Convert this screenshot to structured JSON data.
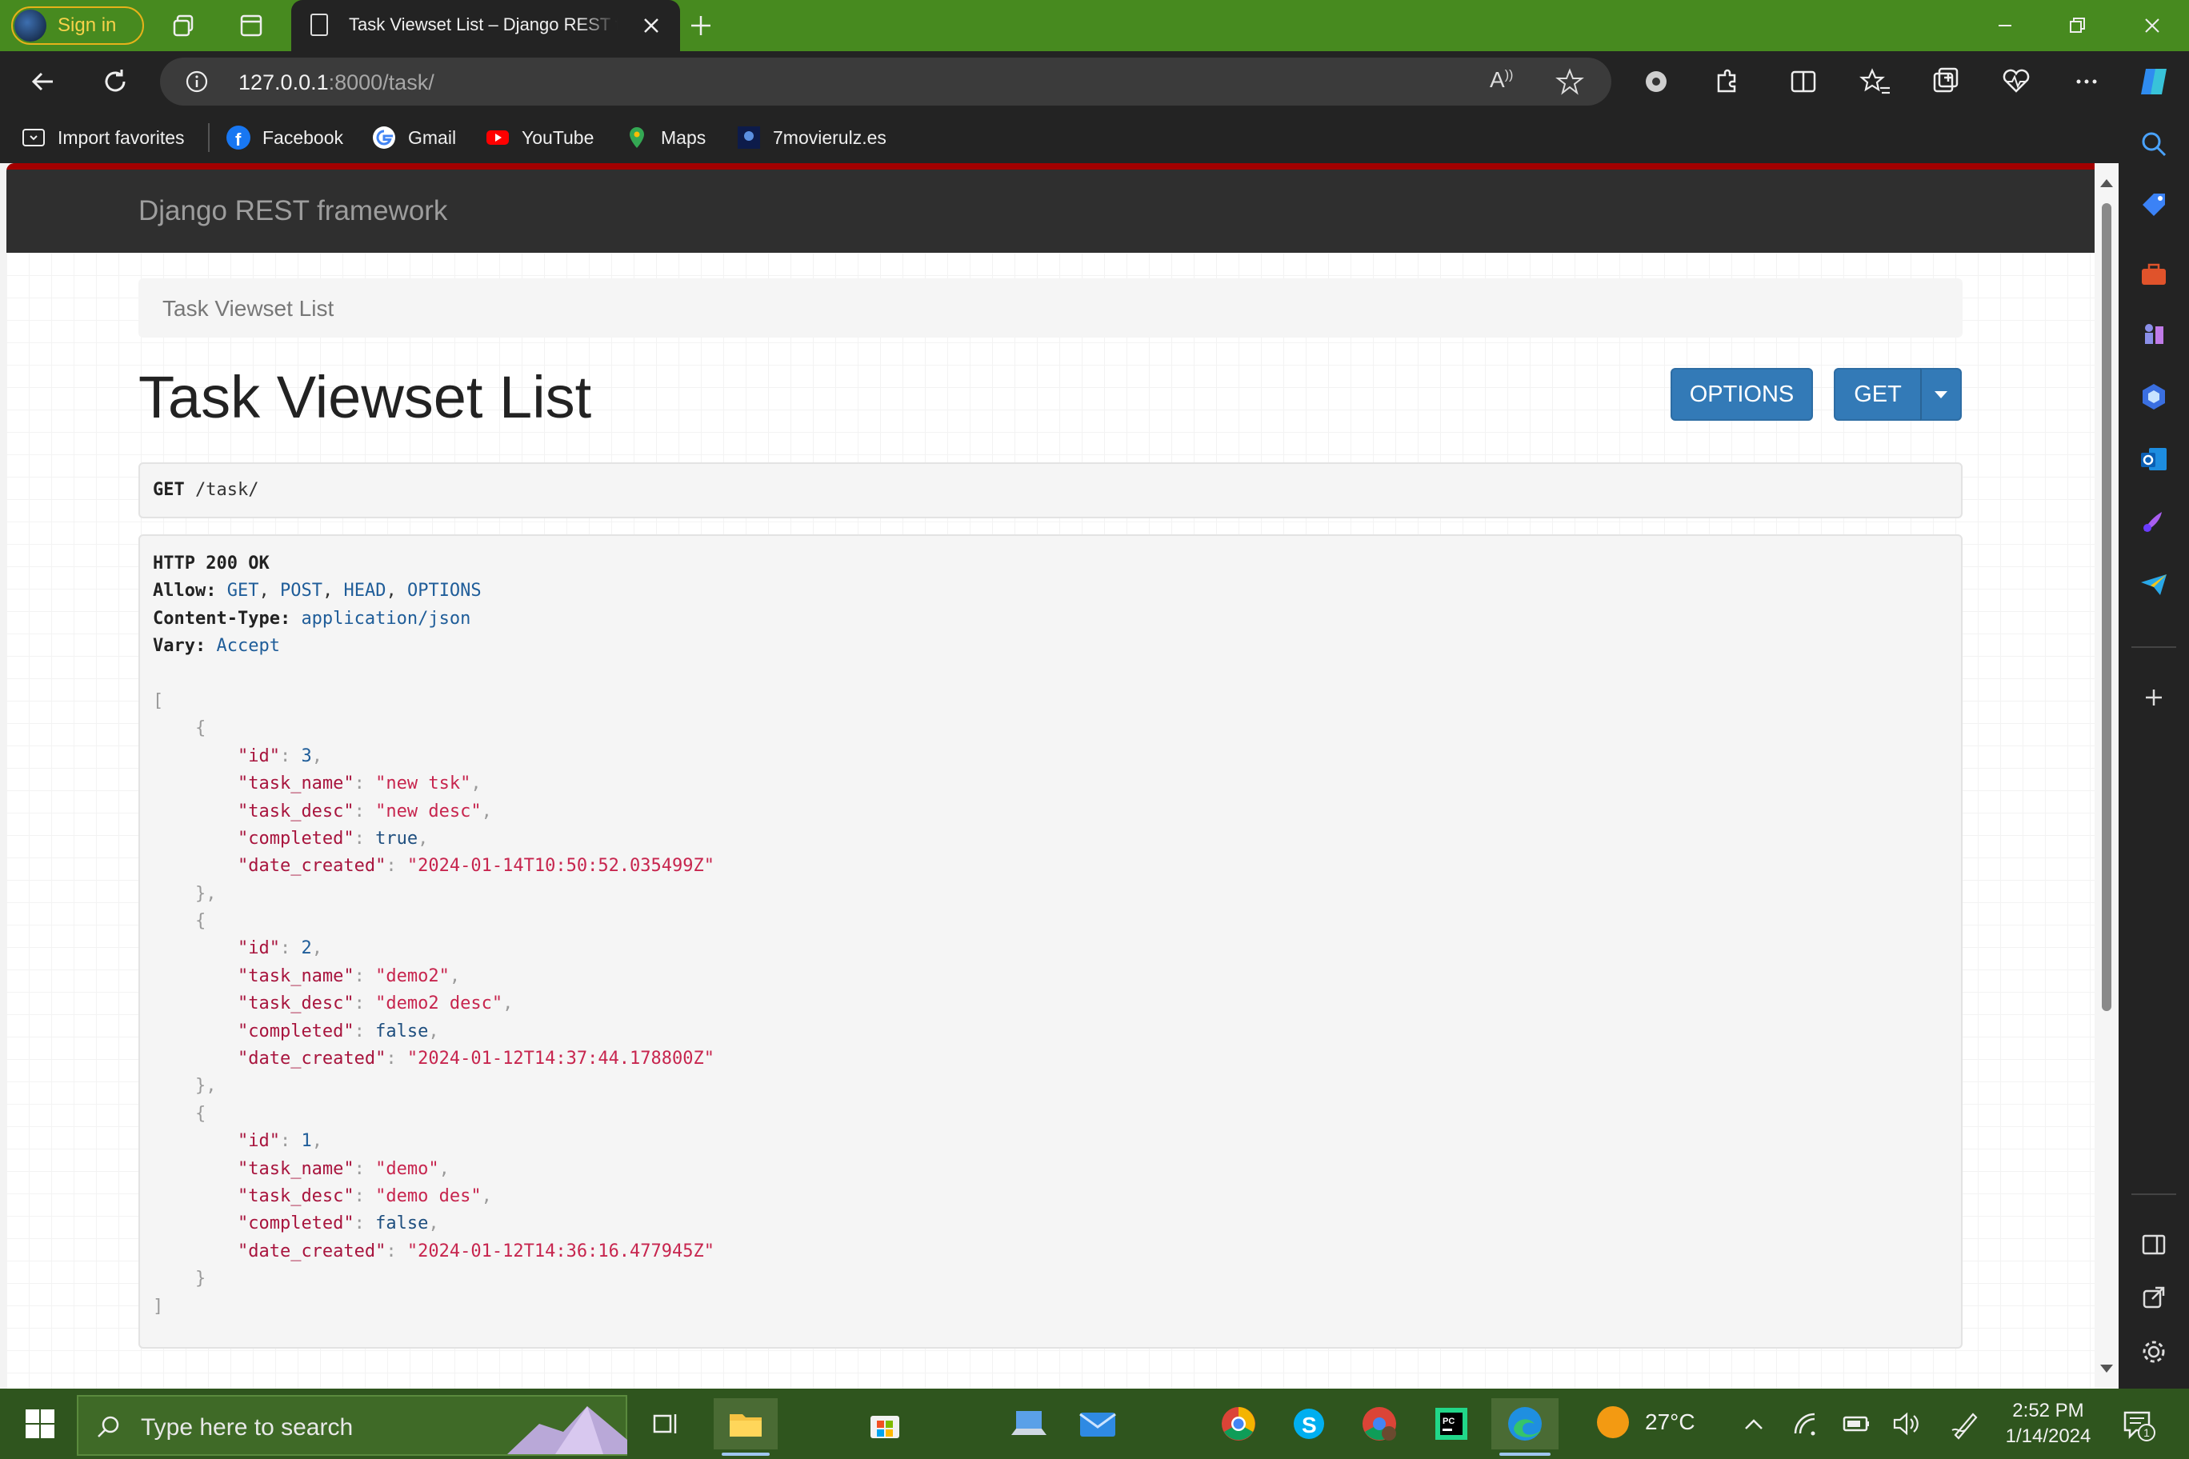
{
  "browser": {
    "signin_label": "Sign in",
    "tab_title": "Task Viewset List – Django REST framework",
    "url_host": "127.0.0.1",
    "url_rest": ":8000/task/"
  },
  "favorites": [
    {
      "label": "Import favorites",
      "icon": "import-favorites-icon"
    },
    {
      "label": "Facebook",
      "icon": "facebook-icon"
    },
    {
      "label": "Gmail",
      "icon": "google-icon"
    },
    {
      "label": "YouTube",
      "icon": "youtube-icon"
    },
    {
      "label": "Maps",
      "icon": "maps-icon"
    },
    {
      "label": "7movierulz.es",
      "icon": "site-icon"
    }
  ],
  "page": {
    "brand": "Django REST framework",
    "breadcrumb": "Task Viewset List",
    "title": "Task Viewset List",
    "options_label": "OPTIONS",
    "get_label": "GET",
    "request_method": "GET",
    "request_path": "/task/",
    "response": {
      "status": "HTTP 200 OK",
      "allow_key": "Allow:",
      "allow_methods": [
        "GET",
        "POST",
        "HEAD",
        "OPTIONS"
      ],
      "content_type_key": "Content-Type:",
      "content_type": "application/json",
      "vary_key": "Vary:",
      "vary": "Accept"
    },
    "tasks": [
      {
        "id": "3",
        "task_name": "\"new tsk\"",
        "task_desc": "\"new desc\"",
        "completed": "true",
        "date_created": "\"2024-01-14T10:50:52.035499Z\""
      },
      {
        "id": "2",
        "task_name": "\"demo2\"",
        "task_desc": "\"demo2 desc\"",
        "completed": "false",
        "date_created": "\"2024-01-12T14:37:44.178800Z\""
      },
      {
        "id": "1",
        "task_name": "\"demo\"",
        "task_desc": "\"demo des\"",
        "completed": "false",
        "date_created": "\"2024-01-12T14:36:16.477945Z\""
      }
    ],
    "json_keys": {
      "id": "\"id\"",
      "task_name": "\"task_name\"",
      "task_desc": "\"task_desc\"",
      "completed": "\"completed\"",
      "date_created": "\"date_created\""
    }
  },
  "taskbar": {
    "search_placeholder": "Type here to search",
    "temperature": "27°C",
    "time": "2:52 PM",
    "date": "1/14/2024",
    "notification_count": "1"
  },
  "colors": {
    "title_bar": "#478a1f",
    "drf_navbar": "#2f2f2f",
    "drf_accent": "#a30000",
    "button": "#337ab7",
    "json_string": "#c7254e"
  }
}
